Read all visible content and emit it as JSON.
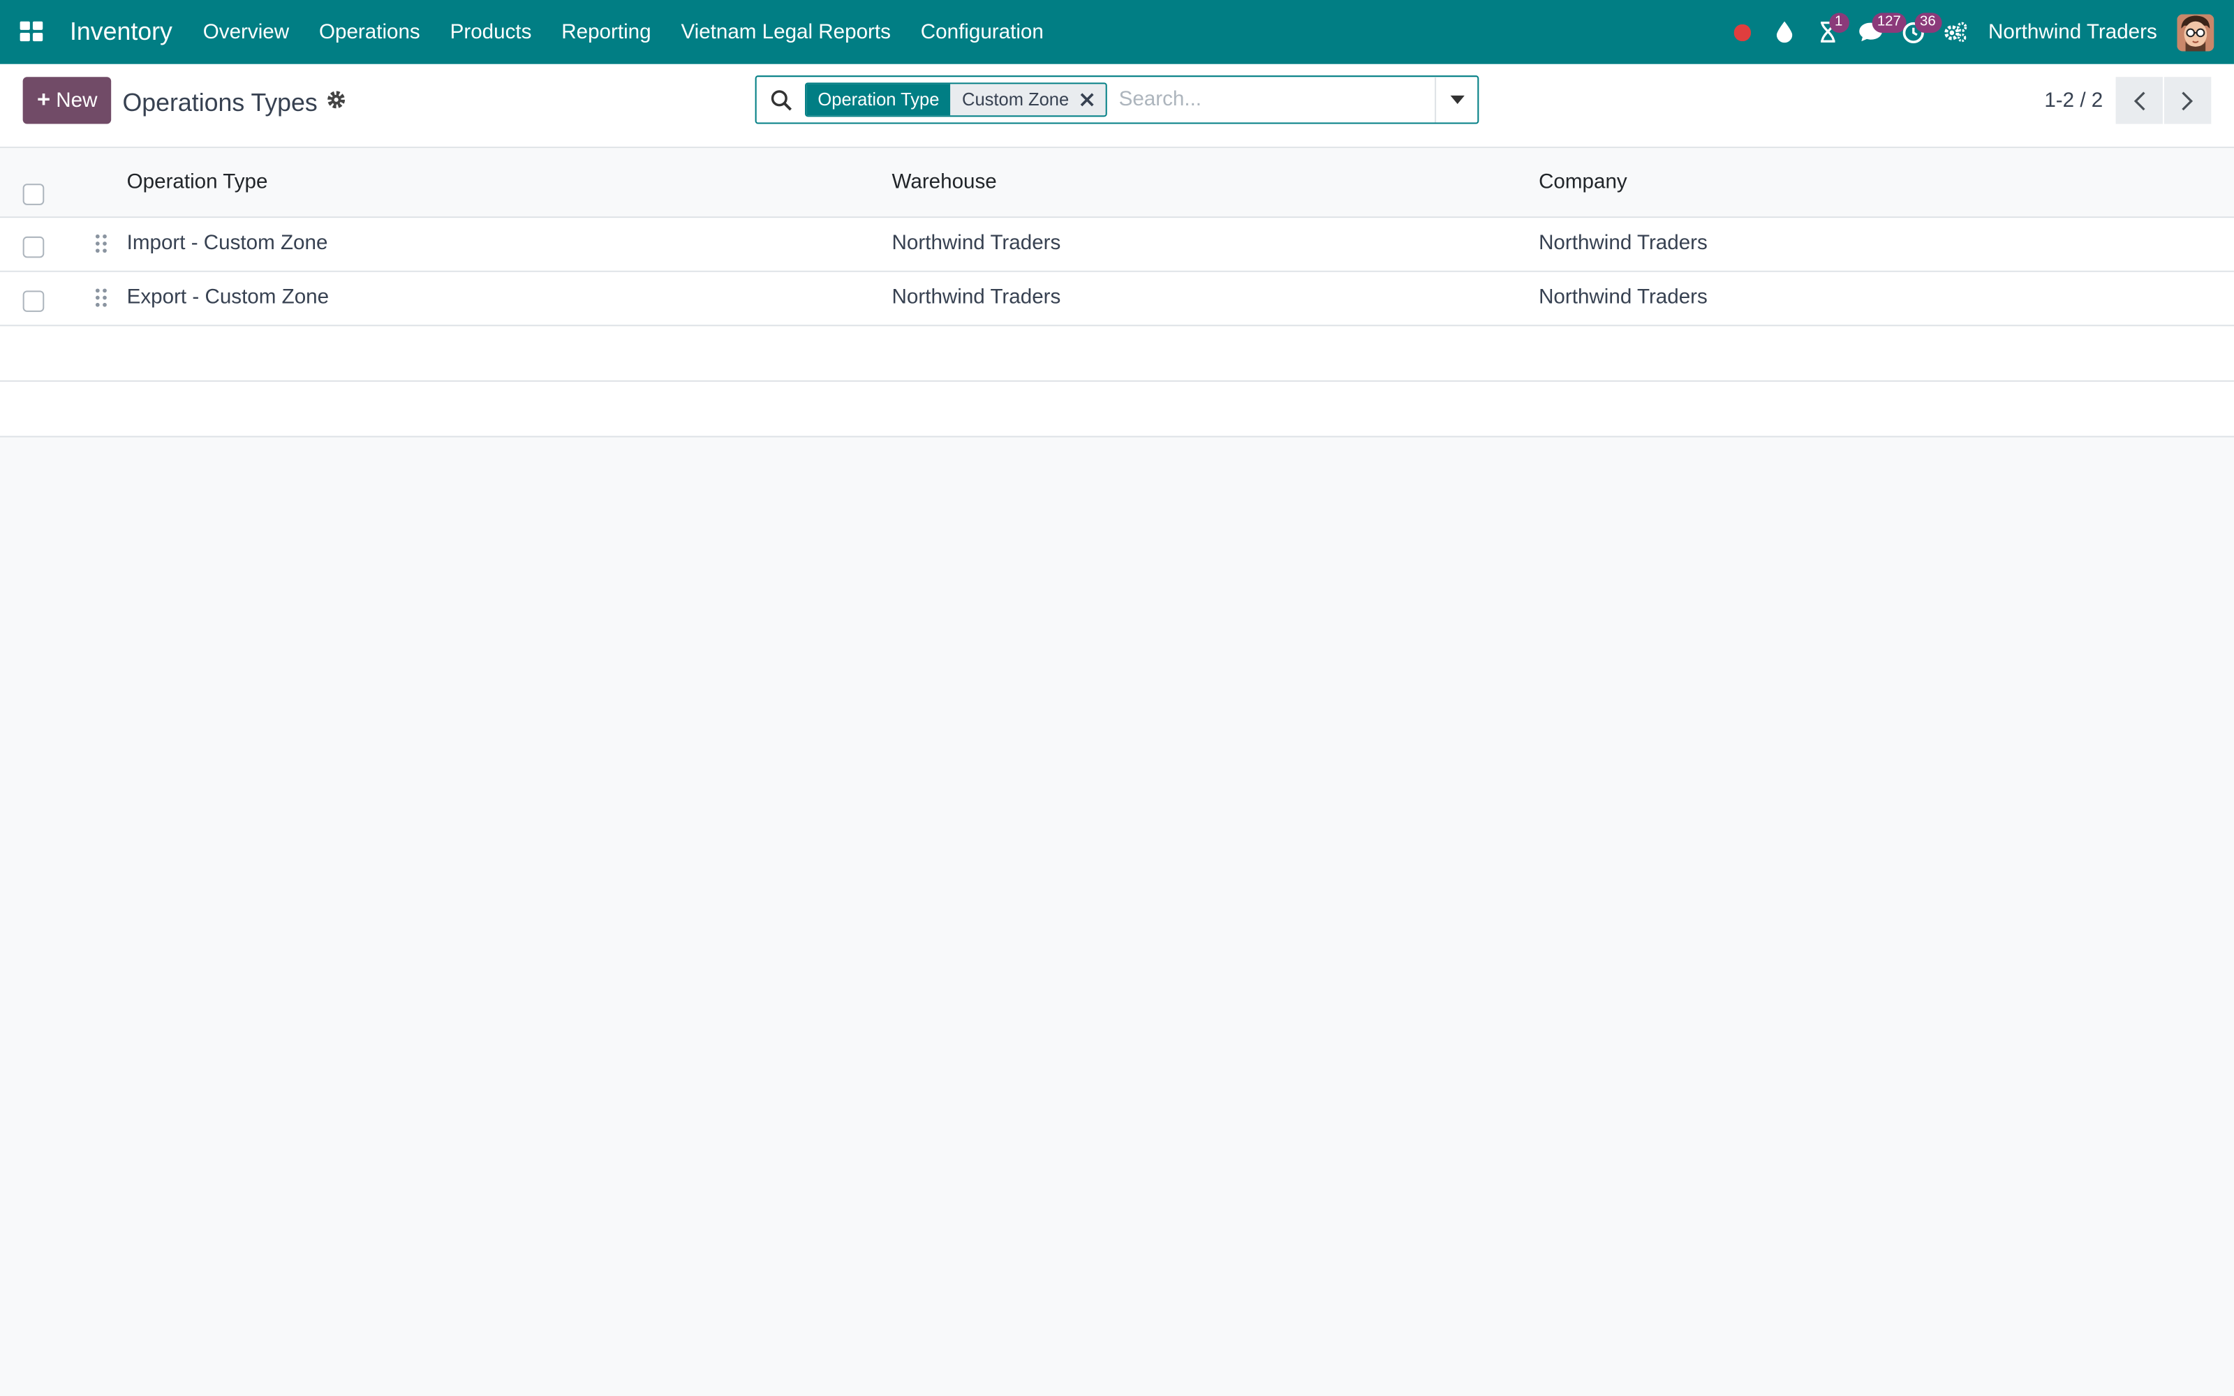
{
  "navbar": {
    "app_name": "Inventory",
    "menu": [
      "Overview",
      "Operations",
      "Products",
      "Reporting",
      "Vietnam Legal Reports",
      "Configuration"
    ],
    "systray": {
      "activity_badge": "1",
      "messages_badge": "127",
      "clock_badge": "36"
    },
    "company": "Northwind Traders"
  },
  "control_panel": {
    "new_label": "New",
    "title": "Operations Types",
    "search": {
      "facet_label": "Operation Type",
      "facet_value": "Custom Zone",
      "placeholder": "Search..."
    },
    "pager": "1-2 / 2"
  },
  "list": {
    "columns": [
      "Operation Type",
      "Warehouse",
      "Company"
    ],
    "rows": [
      {
        "operation_type": "Import - Custom Zone",
        "warehouse": "Northwind Traders",
        "company": "Northwind Traders"
      },
      {
        "operation_type": "Export - Custom Zone",
        "warehouse": "Northwind Traders",
        "company": "Northwind Traders"
      }
    ]
  },
  "colors": {
    "navbar": "#017e84",
    "primary_button": "#714b67",
    "badge": "#8b3a7a",
    "recording_dot": "#e03e3e"
  },
  "icons": [
    "apps-grid-icon",
    "record-dot-icon",
    "drop-icon",
    "hourglass-icon",
    "chat-icon",
    "clock-icon",
    "settings-gears-icon",
    "gear-icon",
    "search-icon",
    "close-icon",
    "caret-down-icon",
    "chevron-left-icon",
    "chevron-right-icon",
    "drag-handle-icon"
  ]
}
